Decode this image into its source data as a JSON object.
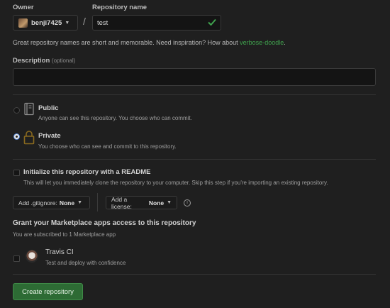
{
  "owner": {
    "label": "Owner",
    "value": "benji7425"
  },
  "separator": "/",
  "repo": {
    "label": "Repository name",
    "value": "test"
  },
  "suggestion": {
    "text": "Great repository names are short and memorable. Need inspiration? How about ",
    "link": "verbose-doodle",
    "suffix": "."
  },
  "description": {
    "label": "Description",
    "optional": "(optional)",
    "value": ""
  },
  "visibility": {
    "public": {
      "title": "Public",
      "desc": "Anyone can see this repository. You choose who can commit.",
      "checked": false
    },
    "private": {
      "title": "Private",
      "desc": "You choose who can see and commit to this repository.",
      "checked": true
    }
  },
  "readme": {
    "title": "Initialize this repository with a README",
    "desc": "This will let you immediately clone the repository to your computer. Skip this step if you're importing an existing repository."
  },
  "gitignore": {
    "label": "Add .gitignore:",
    "value": "None"
  },
  "license": {
    "label": "Add a license:",
    "value": "None"
  },
  "info_glyph": "i",
  "marketplace": {
    "title": "Grant your Marketplace apps access to this repository",
    "subtitle": "You are subscribed to 1 Marketplace app",
    "apps": [
      {
        "name": "Travis CI",
        "desc": "Test and deploy with confidence"
      }
    ]
  },
  "create_button": "Create repository",
  "colors": {
    "accent_green": "#2d6b34",
    "link_green": "#3fa14d",
    "check_green": "#3fa14d"
  }
}
